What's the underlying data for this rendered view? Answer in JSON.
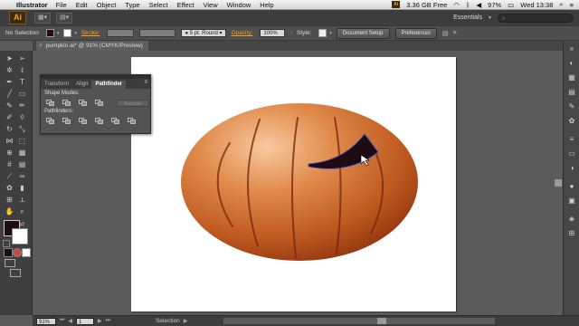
{
  "menubar": {
    "app_name": "Illustrator",
    "items": [
      "File",
      "Edit",
      "Object",
      "Type",
      "Select",
      "Effect",
      "View",
      "Window",
      "Help"
    ],
    "memory": "3.36 GB Free",
    "battery": "97%",
    "clock": "Wed 13:38"
  },
  "appbar": {
    "logo": "Ai",
    "workspace": "Essentials"
  },
  "controlbar": {
    "selection": "No Selection",
    "stroke_label": "Stroke:",
    "brush": "5 pt. Round",
    "opacity_label": "Opacity:",
    "opacity": "100%",
    "style_label": "Style:",
    "document_setup": "Document Setup",
    "preferences": "Preferences",
    "fill_color": "#2a0a12"
  },
  "document": {
    "tab_title": "pumpkin.ai* @ 91% (CMYK/Preview)",
    "close": "×"
  },
  "pathfinder": {
    "tabs": [
      "Transform",
      "Align",
      "Pathfinder"
    ],
    "shape_modes_label": "Shape Modes:",
    "expand_label": "Expand",
    "pathfinders_label": "Pathfinders:"
  },
  "statusbar": {
    "zoom": "91%",
    "artboard": "1",
    "tool": "Selection"
  },
  "colors": {
    "accent": "#f7a21c",
    "pumpkin_light": "#f5c08a",
    "pumpkin_mid": "#d2691e",
    "pumpkin_dark": "#8b2a0a",
    "eye_fill": "#1e0c12"
  }
}
